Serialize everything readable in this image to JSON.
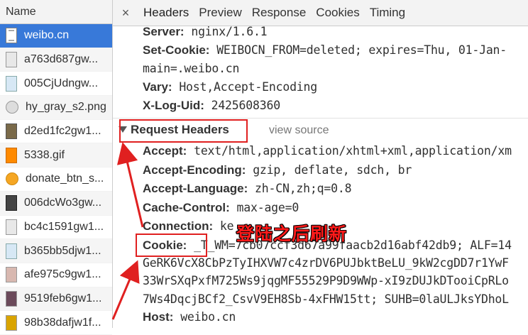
{
  "left_panel": {
    "header": "Name",
    "files": [
      {
        "name": "weibo.cn",
        "icon": "document-icon"
      },
      {
        "name": "a763d687gw...",
        "icon": "image-thumbnail-icon"
      },
      {
        "name": "005CjUdngw...",
        "icon": "image-thumbnail-icon"
      },
      {
        "name": "hy_gray_s2.png",
        "icon": "image-thumbnail-icon"
      },
      {
        "name": "d2ed1fc2gw1...",
        "icon": "image-thumbnail-icon"
      },
      {
        "name": "5338.gif",
        "icon": "gif-thumbnail-icon"
      },
      {
        "name": "donate_btn_s...",
        "icon": "image-thumbnail-icon"
      },
      {
        "name": "006dcWo3gw...",
        "icon": "image-thumbnail-icon"
      },
      {
        "name": "bc4c1591gw1...",
        "icon": "image-thumbnail-icon"
      },
      {
        "name": "b365bb5djw1...",
        "icon": "image-thumbnail-icon"
      },
      {
        "name": "afe975c9gw1...",
        "icon": "image-thumbnail-icon"
      },
      {
        "name": "9519feb6gw1...",
        "icon": "image-thumbnail-icon"
      },
      {
        "name": "98b38dafjw1f...",
        "icon": "image-thumbnail-icon"
      }
    ]
  },
  "tabs": {
    "close": "×",
    "items": [
      "Headers",
      "Preview",
      "Response",
      "Cookies",
      "Timing"
    ],
    "active": "Headers"
  },
  "response_headers": [
    {
      "name": "Server:",
      "value": "nginx/1.6.1"
    },
    {
      "name": "Set-Cookie:",
      "value": "WEIBOCN_FROM=deleted; expires=Thu, 01-Jan-"
    },
    {
      "name": "",
      "value": "main=.weibo.cn"
    },
    {
      "name": "Vary:",
      "value": "Host,Accept-Encoding"
    },
    {
      "name": "X-Log-Uid:",
      "value": "2425608360"
    }
  ],
  "request_section": {
    "title": "Request Headers",
    "view_source": "view source"
  },
  "request_headers": [
    {
      "name": "Accept:",
      "value": "text/html,application/xhtml+xml,application/xm"
    },
    {
      "name": "Accept-Encoding:",
      "value": "gzip, deflate, sdch, br"
    },
    {
      "name": "Accept-Language:",
      "value": "zh-CN,zh;q=0.8"
    },
    {
      "name": "Cache-Control:",
      "value": "max-age=0"
    },
    {
      "name": "Connection:",
      "value": "ke"
    },
    {
      "name": "Cookie:",
      "value": "_T_WM=7cb07ccf3d67a99faacb2d16abf42db9; ALF=14"
    },
    {
      "name": "",
      "value": "GeRK6VcX8CbPzTyIHXVW7c4zrDV6PUJbktBeLU_9kW2cgDD7r1YwF"
    },
    {
      "name": "",
      "value": "33WrSXqPxfM725Ws9jqgMF55529P9D9WWp-xI9zDUJkDTooiCpRLo"
    },
    {
      "name": "",
      "value": "7Ws4DqcjBCf2_CsvV9EH8Sb-4xFHW15tt; SUHB=0laULJksYDhoL"
    },
    {
      "name": "Host:",
      "value": "weibo.cn"
    }
  ],
  "annotation": {
    "text": "登陆之后刷新",
    "color": "#ff1a1a"
  }
}
